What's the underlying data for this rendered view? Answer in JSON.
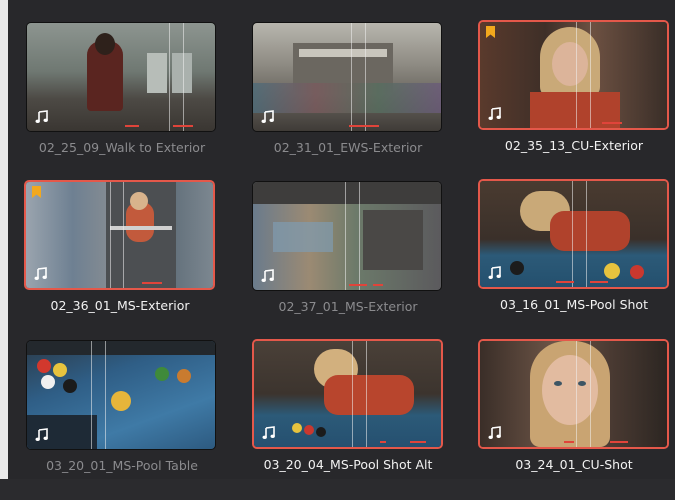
{
  "media_pool": {
    "clips": [
      {
        "name": "02_25_09_Walk to Exterior",
        "selected": false,
        "flagged": false,
        "has_audio": true
      },
      {
        "name": "02_31_01_EWS-Exterior",
        "selected": false,
        "flagged": false,
        "has_audio": true
      },
      {
        "name": "02_35_13_CU-Exterior",
        "selected": true,
        "flagged": true,
        "has_audio": true
      },
      {
        "name": "02_36_01_MS-Exterior",
        "selected": true,
        "flagged": true,
        "has_audio": true
      },
      {
        "name": "02_37_01_MS-Exterior",
        "selected": false,
        "flagged": false,
        "has_audio": true
      },
      {
        "name": "03_16_01_MS-Pool Shot",
        "selected": true,
        "flagged": false,
        "has_audio": true
      },
      {
        "name": "03_20_01_MS-Pool Table",
        "selected": false,
        "flagged": false,
        "has_audio": true
      },
      {
        "name": "03_20_04_MS-Pool Shot Alt",
        "selected": true,
        "flagged": false,
        "has_audio": true
      },
      {
        "name": "03_24_01_CU-Shot",
        "selected": true,
        "flagged": false,
        "has_audio": true
      }
    ]
  },
  "colors": {
    "selection_outline": "#e4584a",
    "flag": "#f2a81d",
    "label_selected": "#f2f2f2",
    "label_unselected": "#8b8b8e",
    "background": "#28282b"
  },
  "icons": {
    "audio": "music-note-icon",
    "flag": "bookmark-flag-icon"
  }
}
